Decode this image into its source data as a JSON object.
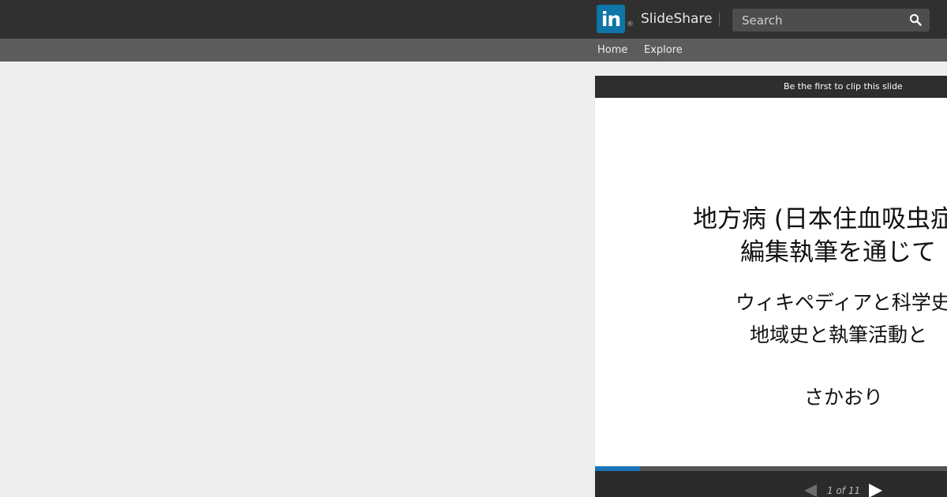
{
  "header": {
    "logo_text": "in",
    "logo_reg": "®",
    "brand": "SlideShare",
    "search_placeholder": "Search"
  },
  "nav": {
    "items": [
      {
        "label": "Home"
      },
      {
        "label": "Explore"
      }
    ]
  },
  "player": {
    "clip_text": "Be the first to clip this slide",
    "slide": {
      "lines": [
        "地方病 (日本住血吸虫症)",
        "編集執筆を通じて",
        "ウィキペディアと科学史",
        "地域史と執筆活動と",
        "さかおり"
      ]
    },
    "progress": 0.127,
    "page_count": "1 of 11"
  },
  "colors": {
    "topbar": "#303030",
    "subnav": "#5c5c5c",
    "page_bg": "#eeeeee",
    "linkedin_blue": "#0e76a8",
    "progress": "#1a74b8"
  },
  "icons": [
    "linkedin-logo-icon",
    "search-icon",
    "prev-arrow-icon",
    "next-arrow-icon"
  ]
}
